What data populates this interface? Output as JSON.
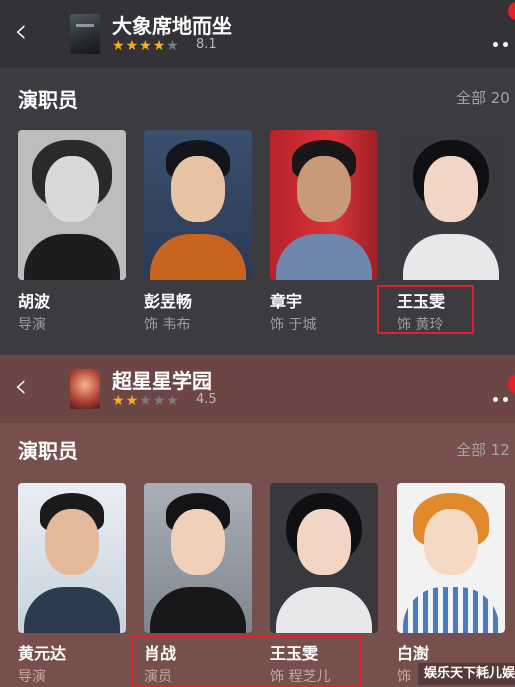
{
  "screens": [
    {
      "movie_title": "大象席地而坐",
      "stars_filled": 4,
      "stars_total": 5,
      "rating": "8.1",
      "section_title": "演职员",
      "all_link": "全部 20",
      "cast": [
        {
          "name": "胡波",
          "role": "导演"
        },
        {
          "name": "彭昱畅",
          "role": "饰 韦布"
        },
        {
          "name": "章宇",
          "role": "饰 于城"
        },
        {
          "name": "王玉雯",
          "role": "饰 黄玲"
        }
      ]
    },
    {
      "movie_title": "超星星学园",
      "stars_filled": 2,
      "stars_total": 5,
      "rating": "4.5",
      "section_title": "演职员",
      "all_link": "全部 12",
      "cast": [
        {
          "name": "黄元达",
          "role": "导演"
        },
        {
          "name": "肖战",
          "role": "演员"
        },
        {
          "name": "王玉雯",
          "role": "饰 程芝儿"
        },
        {
          "name": "白澍",
          "role": "饰"
        }
      ]
    }
  ],
  "icons": {
    "back": "chevron-left-icon",
    "more": "more-dots-icon",
    "star": "star-icon"
  },
  "watermark": "娱乐天下耗儿娱",
  "colors": {
    "star_on": "#ffad1f",
    "highlight": "#e2222b",
    "panel_1_bg": "#3c3b40",
    "panel_2_bg": "#77504e"
  }
}
